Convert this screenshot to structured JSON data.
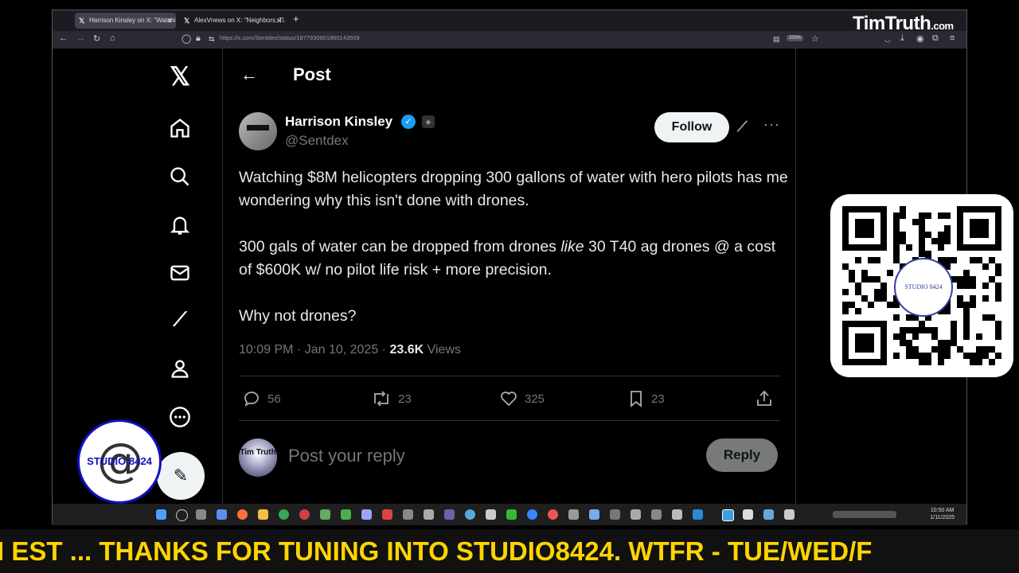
{
  "browser": {
    "tabs": [
      {
        "label": "Harrison Kinsley on X: \"Watchi...",
        "active": true
      },
      {
        "label": "AlexVnews on X: \"Neighbors. Ti...",
        "active": false
      }
    ],
    "url": "https://x.com/Sentdex/status/1877930901860143509",
    "zoom": "200%"
  },
  "brand": {
    "name": "TimTruth",
    "suffix": ".com"
  },
  "sidebar": {
    "items": [
      "x-logo",
      "home",
      "explore",
      "notifications",
      "messages",
      "grok",
      "profile",
      "more"
    ]
  },
  "header": {
    "back": "←",
    "title": "Post"
  },
  "post": {
    "author_name": "Harrison Kinsley",
    "handle": "@Sentdex",
    "follow_label": "Follow",
    "paragraph1": "Watching $8M helicopters dropping 300 gallons of water with hero pilots has me wondering why this isn't done with drones.",
    "paragraph2_before": "300 gals of water can be dropped from drones ",
    "paragraph2_italic": "like",
    "paragraph2_after": " 30 T40 ag drones @ a cost of $600K w/ no pilot life risk + more precision.",
    "paragraph3": "Why not drones?",
    "timestamp": "10:09 PM · Jan 10, 2025 · ",
    "views_count": "23.6K",
    "views_label": " Views",
    "replies": "56",
    "reposts": "23",
    "likes": "325",
    "bookmarks": "23"
  },
  "reply": {
    "avatar_text": "Tim Truth",
    "placeholder": "Post your reply",
    "button_label": "Reply"
  },
  "taskbar": {
    "time": "10:50 AM",
    "date": "1/11/2025"
  },
  "overlay": {
    "qr_label": "STUDIO 8424",
    "logo_text": "STUDIO 8424",
    "logo_symbol": "@",
    "ticker": "I EST ...    THANKS FOR TUNING INTO STUDIO8424.    WTFR - TUE/WED/F"
  },
  "colors": {
    "accent": "#1d9bf0",
    "ticker": "#ffd400",
    "logo_blue": "#1010c0"
  }
}
